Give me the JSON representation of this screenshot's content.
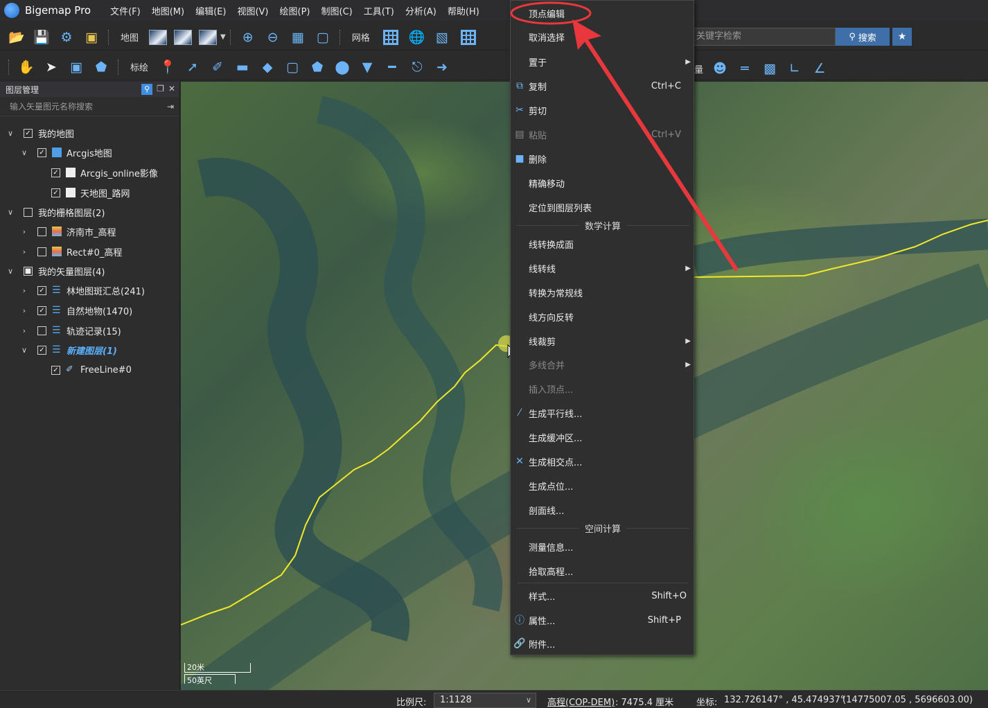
{
  "app": {
    "name": "Bigemap Pro"
  },
  "menubar": [
    "文件(F)",
    "地图(M)",
    "编辑(E)",
    "视图(V)",
    "绘图(P)",
    "制图(C)",
    "工具(T)",
    "分析(A)",
    "帮助(H)"
  ],
  "toolbar1": {
    "map_label": "地图",
    "grid_label": "网格"
  },
  "toolbar2": {
    "mark_label": "标绘",
    "measure_label": "量"
  },
  "search": {
    "placeholder": "关键字检索",
    "button": "搜索"
  },
  "panel": {
    "title": "图层管理",
    "search_placeholder": "输入矢量图元名称搜索",
    "tree": [
      {
        "label": "我的地图",
        "checked": true
      },
      {
        "label": "Arcgis地图",
        "checked": true
      },
      {
        "label": "Arcgis_online影像",
        "checked": true
      },
      {
        "label": "天地图_路网",
        "checked": true
      },
      {
        "label": "我的栅格图层(2)",
        "checked": false
      },
      {
        "label": "济南市_高程",
        "checked": false
      },
      {
        "label": "Rect#0_高程",
        "checked": false
      },
      {
        "label": "我的矢量图层(4)",
        "checked": "partial"
      },
      {
        "label": "林地图斑汇总(241)",
        "checked": true
      },
      {
        "label": "自然地物(1470)",
        "checked": true
      },
      {
        "label": "轨迹记录(15)",
        "checked": false
      },
      {
        "label": "新建图层(1)",
        "checked": true
      },
      {
        "label": "FreeLine#0",
        "checked": true
      }
    ]
  },
  "context_menu": {
    "items": [
      {
        "label": "顶点编辑"
      },
      {
        "label": "取消选择"
      },
      {
        "label": "置于"
      },
      {
        "label": "复制",
        "shortcut": "Ctrl+C"
      },
      {
        "label": "剪切"
      },
      {
        "label": "粘贴",
        "shortcut": "Ctrl+V"
      },
      {
        "label": "删除"
      },
      {
        "label": "精确移动"
      },
      {
        "label": "定位到图层列表"
      },
      {
        "label": "数学计算"
      },
      {
        "label": "线转换成面"
      },
      {
        "label": "线转线"
      },
      {
        "label": "转换为常规线"
      },
      {
        "label": "线方向反转"
      },
      {
        "label": "线裁剪"
      },
      {
        "label": "多线合并"
      },
      {
        "label": "插入顶点..."
      },
      {
        "label": "生成平行线..."
      },
      {
        "label": "生成缓冲区..."
      },
      {
        "label": "生成相交点..."
      },
      {
        "label": "生成点位..."
      },
      {
        "label": "剖面线..."
      },
      {
        "label": "空间计算"
      },
      {
        "label": "测量信息..."
      },
      {
        "label": "拾取高程..."
      },
      {
        "label": "样式...",
        "shortcut": "Shift+O"
      },
      {
        "label": "属性...",
        "shortcut": "Shift+P"
      },
      {
        "label": "附件..."
      }
    ]
  },
  "scalebar": {
    "metric": "20米",
    "imperial": "50英尺"
  },
  "status": {
    "scale_label": "比例尺:",
    "scale_value": "1:1128",
    "elev_label": "高程(COP-DEM)",
    "elev_value": ": 7475.4 厘米",
    "coord_label": "坐标:",
    "coord_value": "132.726147° , 45.474937°",
    "proj_value": "(14775007.05 , 5696603.00)"
  },
  "colors": {
    "accent": "#6cb4f7",
    "annotation": "#e8383d",
    "line": "#f2e82a"
  }
}
